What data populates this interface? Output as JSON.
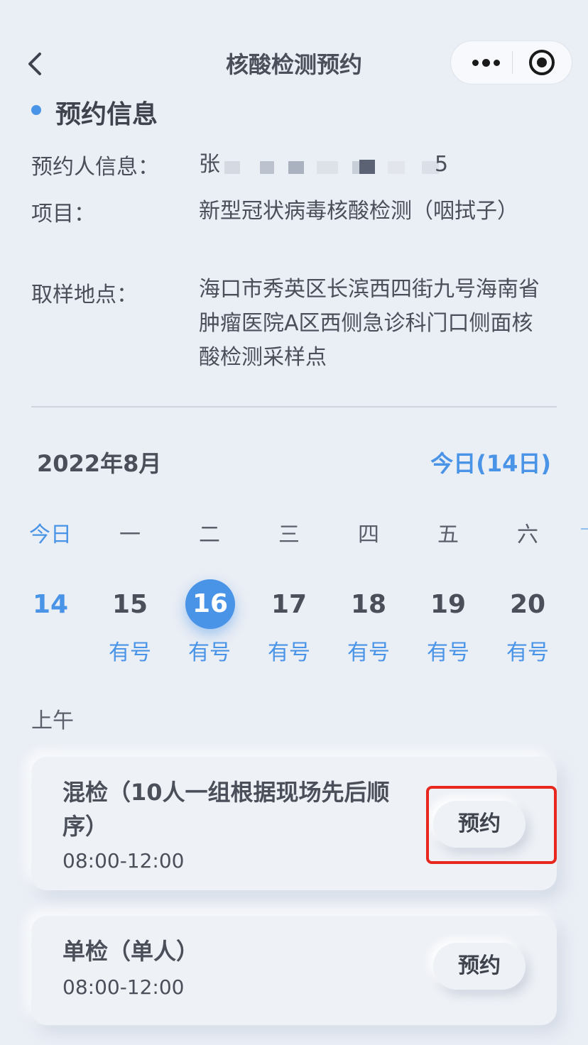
{
  "nav": {
    "title": "核酸检测预约"
  },
  "section": {
    "title": "预约信息"
  },
  "info": {
    "person_label": "预约人信息：",
    "person_value": "张",
    "person_value_tail": "5",
    "project_label": "项目：",
    "project_value": "新型冠状病毒核酸检测（咽拭子）",
    "location_label": "取样地点：",
    "location_value": "海口市秀英区长滨西四街九号海南省肿瘤医院A区西侧急诊科门口侧面核酸检测采样点"
  },
  "calendar": {
    "month": "2022年8月",
    "today_link": "今日(14日)",
    "weekdays": [
      "今日",
      "一",
      "二",
      "三",
      "四",
      "五",
      "六"
    ],
    "days": [
      "14",
      "15",
      "16",
      "17",
      "18",
      "19",
      "20"
    ],
    "selected_index": 2,
    "availability": [
      "",
      "有号",
      "有号",
      "有号",
      "有号",
      "有号",
      "有号"
    ]
  },
  "period_label": "上午",
  "slots": [
    {
      "title": "混检（10人一组根据现场先后顺序）",
      "time": "08:00-12:00",
      "button": "预约"
    },
    {
      "title": "单检（单人）",
      "time": "08:00-12:00",
      "button": "预约"
    }
  ],
  "colors": {
    "accent": "#4a94e8",
    "highlight": "#e8281e",
    "background": "#eaeef5"
  }
}
